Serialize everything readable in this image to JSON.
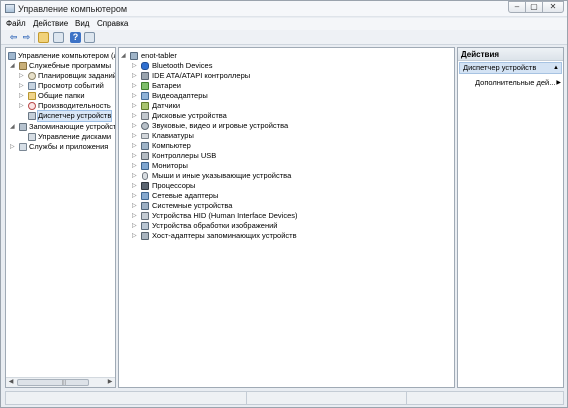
{
  "window": {
    "title": "Управление компьютером",
    "controls": {
      "minimize": "–",
      "maximize": "▢",
      "close": "✕"
    }
  },
  "menu": [
    "Файл",
    "Действие",
    "Вид",
    "Справка"
  ],
  "toolbar": {
    "icons": [
      "back-arrow-icon",
      "forward-arrow-icon",
      "up-folder-icon",
      "show-hide-tree-icon",
      "help-icon",
      "properties-icon"
    ],
    "glyphs": {
      "back": "⇦",
      "forward": "⇨",
      "help": "?"
    }
  },
  "tree": {
    "root": "Управление компьютером (л",
    "items": [
      {
        "label": "Служебные программы",
        "icon": "tools-icon"
      },
      {
        "label": "Планировщик заданий",
        "icon": "task-scheduler-icon"
      },
      {
        "label": "Просмотр событий",
        "icon": "event-viewer-icon"
      },
      {
        "label": "Общие папки",
        "icon": "shared-folders-icon"
      },
      {
        "label": "Производительность",
        "icon": "performance-icon"
      },
      {
        "label": "Диспетчер устройств",
        "icon": "device-manager-icon"
      },
      {
        "label": "Запоминающие устройств",
        "icon": "storage-icon"
      },
      {
        "label": "Управление дисками",
        "icon": "disk-management-icon"
      },
      {
        "label": "Службы и приложения",
        "icon": "services-icon"
      }
    ]
  },
  "devices": {
    "root": "enot-tabler",
    "items": [
      {
        "label": "Bluetooth Devices",
        "icon": "bluetooth-icon"
      },
      {
        "label": "IDE ATA/ATAPI контроллеры",
        "icon": "ide-controller-icon"
      },
      {
        "label": "Батареи",
        "icon": "battery-icon"
      },
      {
        "label": "Видеоадаптеры",
        "icon": "display-adapter-icon"
      },
      {
        "label": "Датчики",
        "icon": "sensor-icon"
      },
      {
        "label": "Дисковые устройства",
        "icon": "disk-drive-icon"
      },
      {
        "label": "Звуковые, видео и игровые устройства",
        "icon": "sound-icon"
      },
      {
        "label": "Клавиатуры",
        "icon": "keyboard-icon"
      },
      {
        "label": "Компьютер",
        "icon": "computer-icon"
      },
      {
        "label": "Контроллеры USB",
        "icon": "usb-icon"
      },
      {
        "label": "Мониторы",
        "icon": "monitor-icon"
      },
      {
        "label": "Мыши и иные указывающие устройства",
        "icon": "mouse-icon"
      },
      {
        "label": "Процессоры",
        "icon": "processor-icon"
      },
      {
        "label": "Сетевые адаптеры",
        "icon": "network-adapter-icon"
      },
      {
        "label": "Системные устройства",
        "icon": "system-device-icon"
      },
      {
        "label": "Устройства HID (Human Interface Devices)",
        "icon": "hid-icon"
      },
      {
        "label": "Устройства обработки изображений",
        "icon": "imaging-device-icon"
      },
      {
        "label": "Хост-адаптеры запоминающих устройств",
        "icon": "storage-controller-icon"
      }
    ]
  },
  "actions": {
    "header": "Действия",
    "section": "Диспетчер устройств",
    "item": "Дополнительные дей...",
    "arrows": {
      "collapse": "▲",
      "more": "▶"
    }
  },
  "glyphs": {
    "expanded": "◢",
    "collapsed": "▷",
    "scroll_left": "◀",
    "scroll_right": "▶",
    "grip": "|||"
  },
  "colors": {
    "selection": "#d9e7f7",
    "accent": "#3d73c6"
  }
}
